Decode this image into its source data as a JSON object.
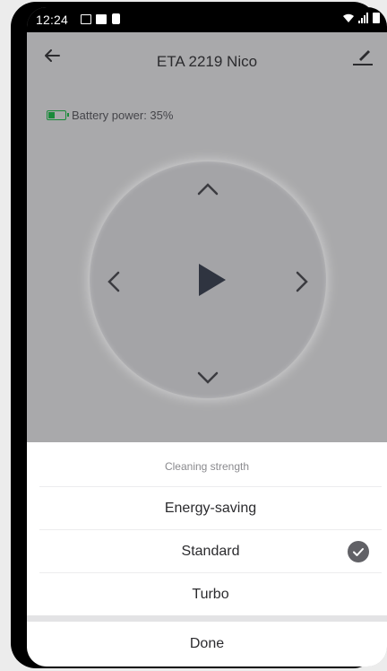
{
  "status_bar": {
    "time": "12:24",
    "left_icons": [
      "image-icon",
      "flipboard-icon",
      "trash-icon"
    ],
    "right_icons": [
      "wifi-icon",
      "signal-icon",
      "battery-icon"
    ]
  },
  "app_bar": {
    "title": "ETA 2219 Nico",
    "back_icon": "arrow-left-icon",
    "edit_icon": "pen-icon"
  },
  "battery": {
    "label": "Battery power: 35%",
    "level": 0.35,
    "color": "#1a8a3a"
  },
  "dpad": {
    "up": "chevron-up-icon",
    "down": "chevron-down-icon",
    "left": "chevron-left-icon",
    "right": "chevron-right-icon",
    "center": "play-icon"
  },
  "sheet": {
    "title": "Cleaning strength",
    "options": [
      {
        "label": "Energy-saving",
        "selected": false
      },
      {
        "label": "Standard",
        "selected": true
      },
      {
        "label": "Turbo",
        "selected": false
      }
    ],
    "done_label": "Done"
  }
}
